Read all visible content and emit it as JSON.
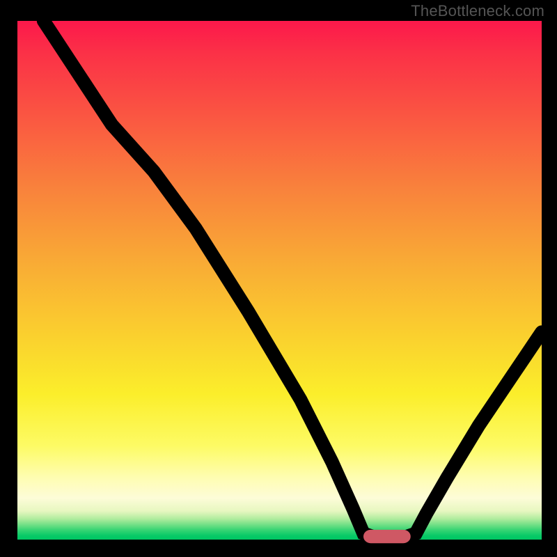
{
  "watermark": "TheBottleneck.com",
  "chart_data": {
    "type": "line",
    "title": "",
    "xlabel": "",
    "ylabel": "",
    "xlim": [
      0,
      100
    ],
    "ylim": [
      0,
      100
    ],
    "grid": false,
    "legend": false,
    "curve_points": [
      {
        "x": 5,
        "y": 100
      },
      {
        "x": 18,
        "y": 80
      },
      {
        "x": 26,
        "y": 71
      },
      {
        "x": 34,
        "y": 60
      },
      {
        "x": 44,
        "y": 44
      },
      {
        "x": 54,
        "y": 27
      },
      {
        "x": 60,
        "y": 15
      },
      {
        "x": 64,
        "y": 6
      },
      {
        "x": 66,
        "y": 1.2
      },
      {
        "x": 68,
        "y": 0.5
      },
      {
        "x": 71,
        "y": 0.5
      },
      {
        "x": 74,
        "y": 0.5
      },
      {
        "x": 76,
        "y": 1.2
      },
      {
        "x": 78,
        "y": 5
      },
      {
        "x": 82,
        "y": 12
      },
      {
        "x": 88,
        "y": 22
      },
      {
        "x": 94,
        "y": 31
      },
      {
        "x": 100,
        "y": 40
      }
    ],
    "marker": {
      "x_start": 66.5,
      "x_end": 74.5,
      "y": 0.6
    },
    "background_gradient": [
      {
        "pos": 0,
        "color": "#fc184b"
      },
      {
        "pos": 50,
        "color": "#f9a336"
      },
      {
        "pos": 80,
        "color": "#fdfb65"
      },
      {
        "pos": 100,
        "color": "#00c764"
      }
    ]
  }
}
